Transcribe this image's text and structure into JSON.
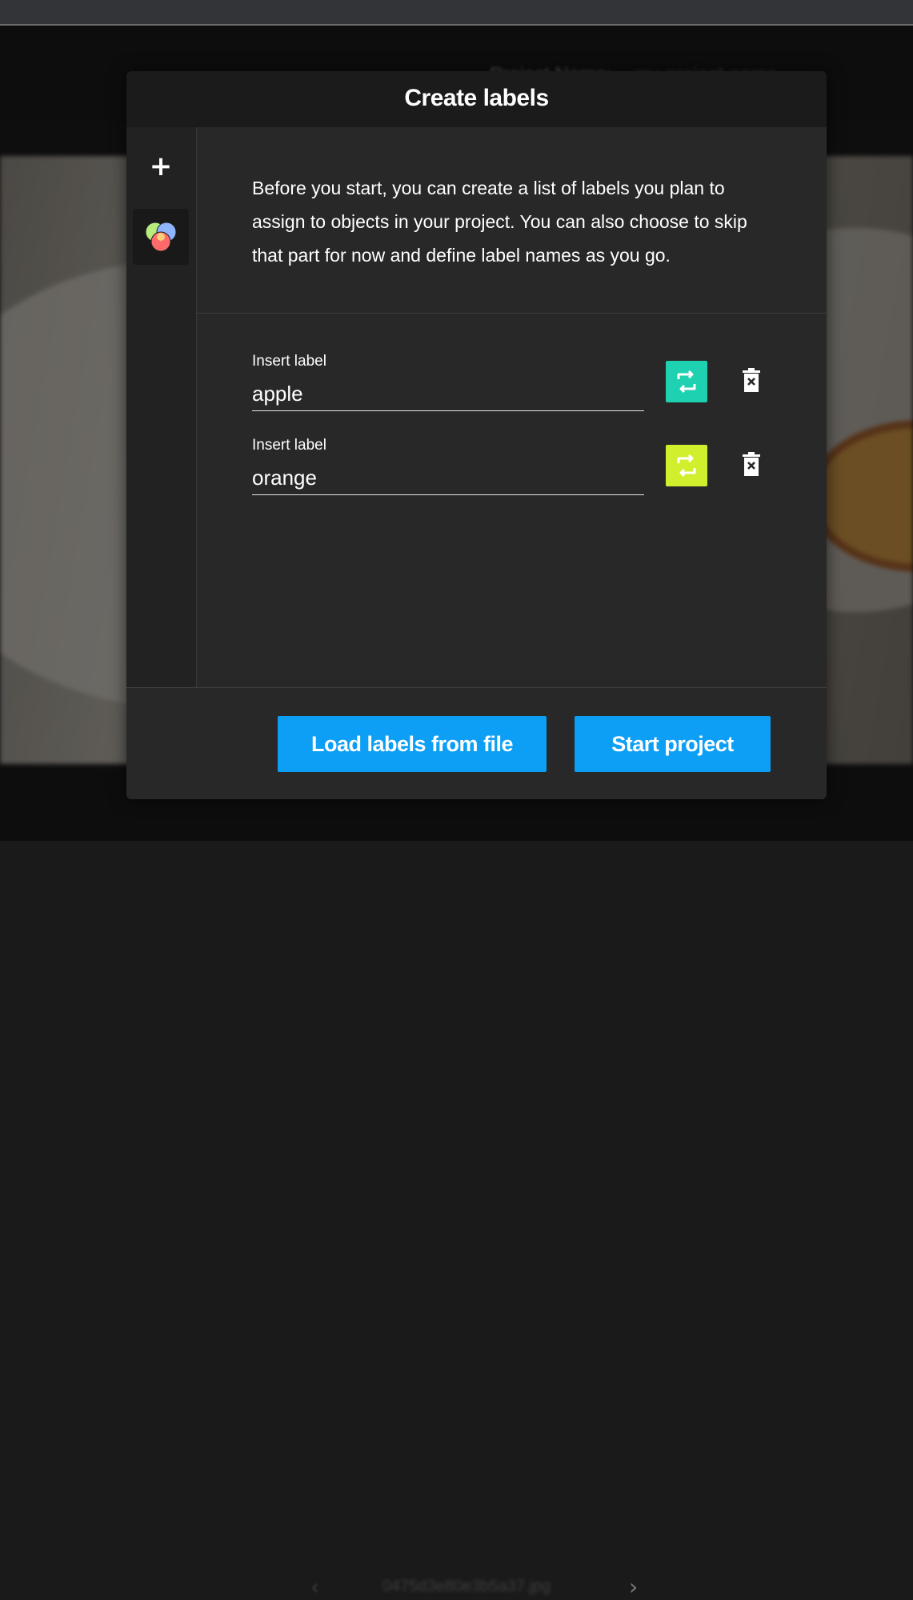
{
  "background": {
    "project_name_label": "Project Name:",
    "project_name_value": "my-project-name",
    "file_name": "0475d3e80e3b5a37.jpg",
    "prev_icon": "chevron-left-icon",
    "next_icon": "chevron-right-icon"
  },
  "modal": {
    "title": "Create labels",
    "add_icon": "plus-icon",
    "add_glyph": "+",
    "labels_tool_icon": "color-circles-icon",
    "description": "Before you start, you can create a list of labels you plan to assign to objects in your project. You can also choose to skip that part for now and define label names as you go.",
    "labels": [
      {
        "caption": "Insert label",
        "value": "apple",
        "color": "#1dd1b1",
        "color_icon": "refresh-color-icon",
        "delete_icon": "delete-icon"
      },
      {
        "caption": "Insert label",
        "value": "orange",
        "color": "#d2ef2e",
        "color_icon": "refresh-color-icon",
        "delete_icon": "delete-icon"
      }
    ],
    "buttons": {
      "load_labels": "Load labels from file",
      "start_project": "Start project"
    }
  },
  "colors": {
    "accent": "#0d9ef5",
    "modal_bg": "#282828",
    "header_bg": "#1b1b1b"
  }
}
